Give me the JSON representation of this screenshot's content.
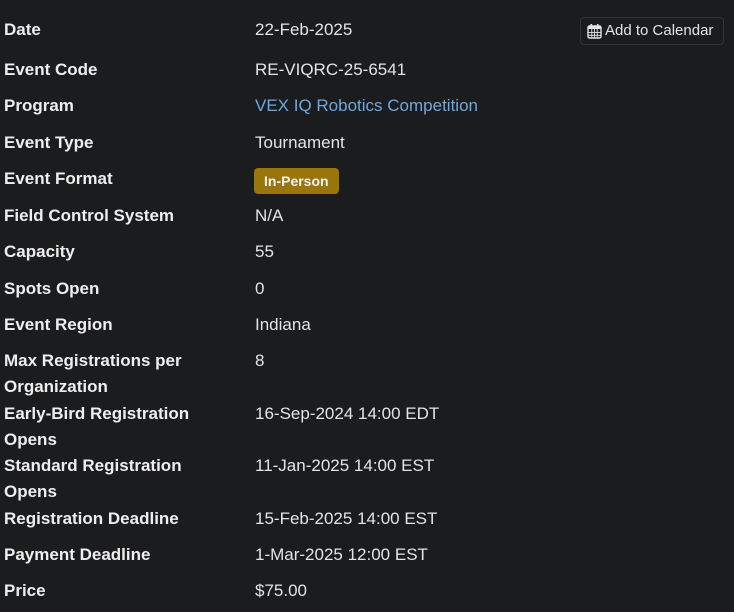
{
  "add_to_calendar": {
    "label": "Add to Calendar",
    "icon": "calendar-icon"
  },
  "colors": {
    "background": "#1b1c1e",
    "link": "#6ea8e0",
    "badge": "#9a7509"
  },
  "rows": [
    {
      "label": "Date",
      "value": "22-Feb-2025"
    },
    {
      "label": "Event Code",
      "value": "RE-VIQRC-25-6541"
    },
    {
      "label": "Program",
      "value": "VEX IQ Robotics Competition"
    },
    {
      "label": "Event Type",
      "value": "Tournament"
    },
    {
      "label": "Event Format",
      "value": "In-Person"
    },
    {
      "label": "Field Control System",
      "value": "N/A"
    },
    {
      "label": "Capacity",
      "value": "55"
    },
    {
      "label": "Spots Open",
      "value": "0"
    },
    {
      "label": "Event Region",
      "value": "Indiana"
    },
    {
      "label": "Max Registrations per Organization",
      "value": "8"
    },
    {
      "label": "Early-Bird Registration Opens",
      "value": "16-Sep-2024 14:00 EDT"
    },
    {
      "label": "Standard Registration Opens",
      "value": "11-Jan-2025 14:00 EST"
    },
    {
      "label": "Registration Deadline",
      "value": "15-Feb-2025 14:00 EST"
    },
    {
      "label": "Payment Deadline",
      "value": "1-Mar-2025 12:00 EST"
    },
    {
      "label": "Price",
      "value": "$75.00"
    }
  ]
}
